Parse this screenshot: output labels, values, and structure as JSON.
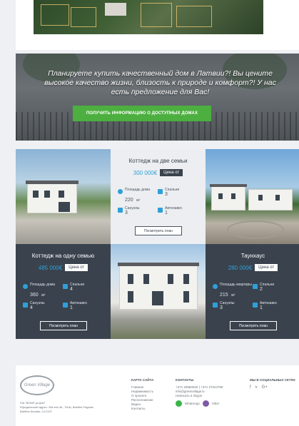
{
  "banner": {
    "text": "Планируете купить качественный дом в Латвии?! Вы цените высокое качество жизни, близость к природе и комфорт?! У нас есть предложение для Вас!",
    "cta": "ПОЛУЧИТЬ ИНФОРМАЦИЮ О ДОСТУПНЫХ ДОМАХ"
  },
  "cards": [
    {
      "title": "Коттедж на две семьи",
      "price": "300 000€",
      "badge": "Цена от",
      "area_label": "Площадь дома",
      "area_value": "220",
      "area_unit": "м²",
      "bedrooms_label": "Спальни",
      "bedrooms_value": "3",
      "bathrooms_label": "Санузлы",
      "bathrooms_value": "3",
      "parking_label": "Автонавес",
      "parking_value": "1",
      "plan_btn": "Посмотреть план"
    },
    {
      "title": "Коттедж на одну семью",
      "price": "485 000€",
      "badge": "Цена от",
      "area_label": "Площадь дома",
      "area_value": "360",
      "area_unit": "м²",
      "bedrooms_label": "Спальни",
      "bedrooms_value": "4",
      "bathrooms_label": "Санузлы",
      "bathrooms_value": "4",
      "parking_label": "Автонавес",
      "parking_value": "1",
      "plan_btn": "Посмотреть план"
    },
    {
      "title": "Таунхаус",
      "price": "280 000€",
      "badge": "Цена от",
      "area_label": "Площадь квартиры",
      "area_value": "215",
      "area_unit": "м²",
      "bedrooms_label": "Спальни",
      "bedrooms_value": "2",
      "bathrooms_label": "Санузлы",
      "bathrooms_value": "3",
      "parking_label": "Автонавес",
      "parking_value": "1",
      "plan_btn": "Посмотреть план"
    }
  ],
  "footer": {
    "logo": "Green Village",
    "address_1": "SIA \"BOMP-projekt\"",
    "address_2": "Юридический адрес: Zilā iela 3A , Piņķi, Babītes Pagasts",
    "address_3": "Babītes Novads, LV-2107",
    "sitemap_title": "КАРТА САЙТА",
    "sitemap": [
      "Главная",
      "Недвижимость",
      "О проекте",
      "Расположение",
      "Видео",
      "Контакты"
    ],
    "contacts_title": "КОНТАКТЫ",
    "phone": "+371 20560020 | +371 27024790",
    "email": "info@greenvillage.lv",
    "write": "Написать в Skype",
    "whatsapp": "WhatsApp",
    "viber": "Viber",
    "social_title": "МЫ В СОЦИАЛЬНЫХ СЕТЯХ",
    "social": [
      "f",
      "v",
      "G+"
    ]
  },
  "colors": {
    "accent_green": "#4caf3f",
    "price_blue": "#2ea0d8",
    "dark_panel": "#3a424d"
  }
}
